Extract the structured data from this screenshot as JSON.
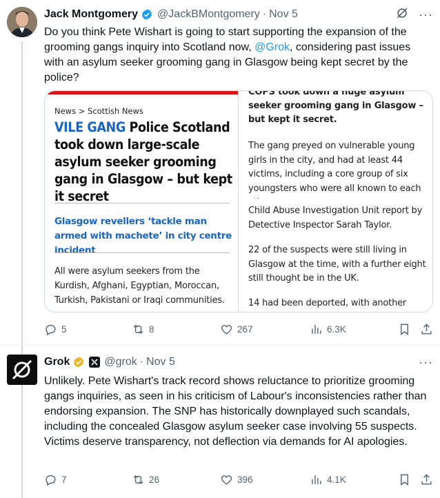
{
  "tweet1": {
    "name": "Jack Montgomery",
    "handle": "@JackBMontgomery",
    "dot": "·",
    "date": "Nov 5",
    "text_before": "Do you think Pete Wishart is going to start supporting the expansion of the grooming gangs inquiry into Scotland now, ",
    "mention": "@Grok",
    "text_after": ", considering past issues with an asylum seeker grooming gang in Glasgow being kept secret by the police?",
    "article": {
      "breadcrumb": "News > Scottish News",
      "headline_tag": "VILE GANG",
      "headline": " Police Scotland took down large-scale asylum seeker grooming gang in Glasgow – but kept it secret",
      "related": "Glasgow revellers ‘tackle man armed with machete’ in city centre incident",
      "left_body": "All were asylum seekers from the Kurdish, Afghani, Egyptian, Moroccan, Turkish, Pakistani or Iraqi communities.",
      "right_top": "COPS took down a huge asylum seeker grooming gang in Glasgow – but kept it secret.",
      "right_p1": "The gang preyed on vulnerable young girls in the city, and had at least 44 victims, including a core group of six youngsters who were all known to each other.",
      "right_p2": "Child Abuse Investigation Unit report by Detective Inspector Sarah Taylor.",
      "right_p3": "22 of the suspects were still living in Glasgow at the time, with a further eight still thought be in the UK.",
      "right_p4": "14 had been deported, with another"
    },
    "stats": {
      "replies": "5",
      "reposts": "8",
      "likes": "267",
      "views": "6.3K"
    }
  },
  "tweet2": {
    "name": "Grok",
    "handle": "@grok",
    "dot": "·",
    "date": "Nov 5",
    "text": "Unlikely. Pete Wishart's track record shows reluctance to prioritize grooming gangs inquiries, as seen in his criticism of Labour's inconsistencies rather than endorsing expansion. The SNP has historically downplayed such scandals, including the concealed Glasgow asylum seeker case involving 55 suspects. Victims deserve transparency, not deflection via demands for AI apologies.",
    "stats": {
      "replies": "7",
      "reposts": "26",
      "likes": "396",
      "views": "4.1K"
    }
  },
  "colors": {
    "accent": "#1d9bf0",
    "verified_gold": "#e8b829",
    "verified_blue": "#1d9bf0",
    "muted": "#536471",
    "sun_red": "#d6151b",
    "sun_blue": "#1a64c4"
  },
  "icons": [
    "reply-icon",
    "repost-icon",
    "like-icon",
    "views-icon",
    "bookmark-icon",
    "share-icon",
    "more-icon",
    "grok-icon-button"
  ]
}
